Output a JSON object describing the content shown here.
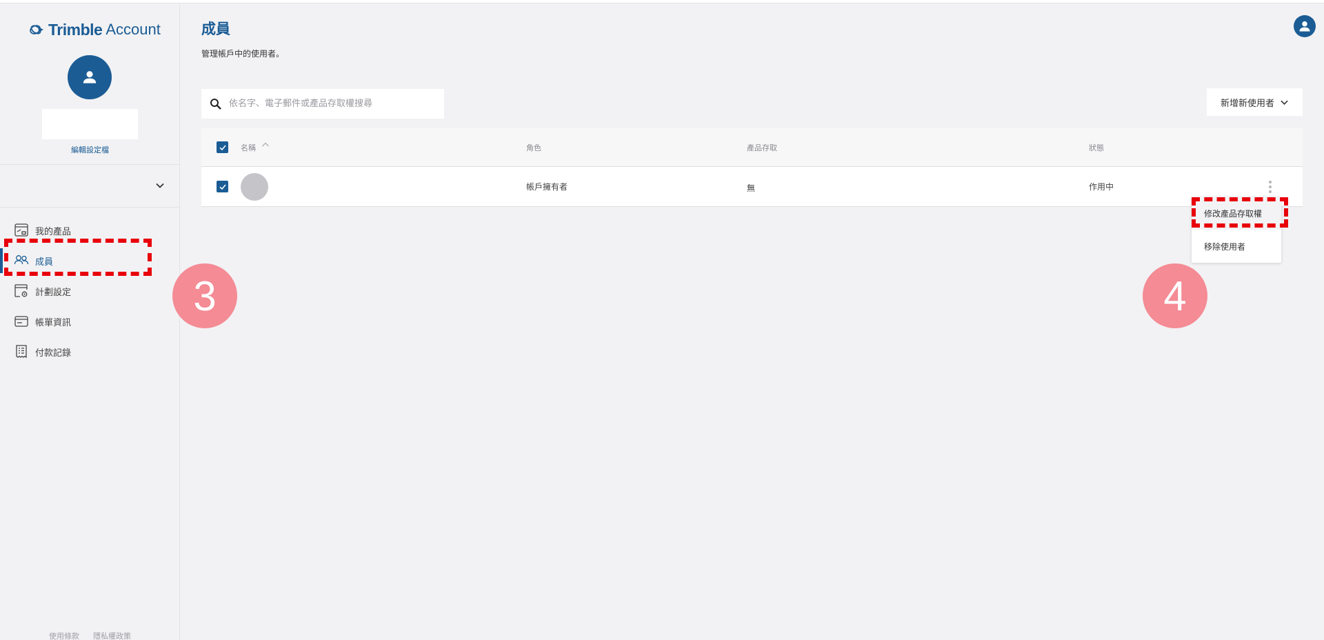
{
  "app": {
    "brand_strong": "Trimble",
    "brand_light": "Account",
    "accent_color": "#1b5c95"
  },
  "sidebar": {
    "edit_profile_label": "編輯設定檔",
    "items": [
      {
        "label": "我的產品",
        "icon": "product-window-icon",
        "active": false
      },
      {
        "label": "成員",
        "icon": "users-icon",
        "active": true
      },
      {
        "label": "計劃設定",
        "icon": "plan-settings-icon",
        "active": false
      },
      {
        "label": "帳單資訊",
        "icon": "billing-card-icon",
        "active": false
      },
      {
        "label": "付款記錄",
        "icon": "receipt-icon",
        "active": false
      }
    ],
    "footer": {
      "terms": "使用條款",
      "privacy": "隱私權政策"
    }
  },
  "main": {
    "title": "成員",
    "subtitle": "管理帳戶中的使用者。",
    "search": {
      "placeholder": "依名字、電子郵件或產品存取權搜尋",
      "value": ""
    },
    "add_user_button": "新增新使用者",
    "table": {
      "columns": [
        "名稱",
        "角色",
        "產品存取",
        "狀態"
      ],
      "select_all_checked": true,
      "rows": [
        {
          "name": "",
          "role": "帳戶擁有者",
          "product_access": "無",
          "status": "作用中",
          "checked": true
        }
      ]
    },
    "row_menu": {
      "items": [
        "修改產品存取權",
        "移除使用者"
      ]
    }
  },
  "annotations": {
    "step_3": "3",
    "step_4": "4",
    "highlight_color": "#e8000b",
    "circle_color": "#f48b95"
  }
}
